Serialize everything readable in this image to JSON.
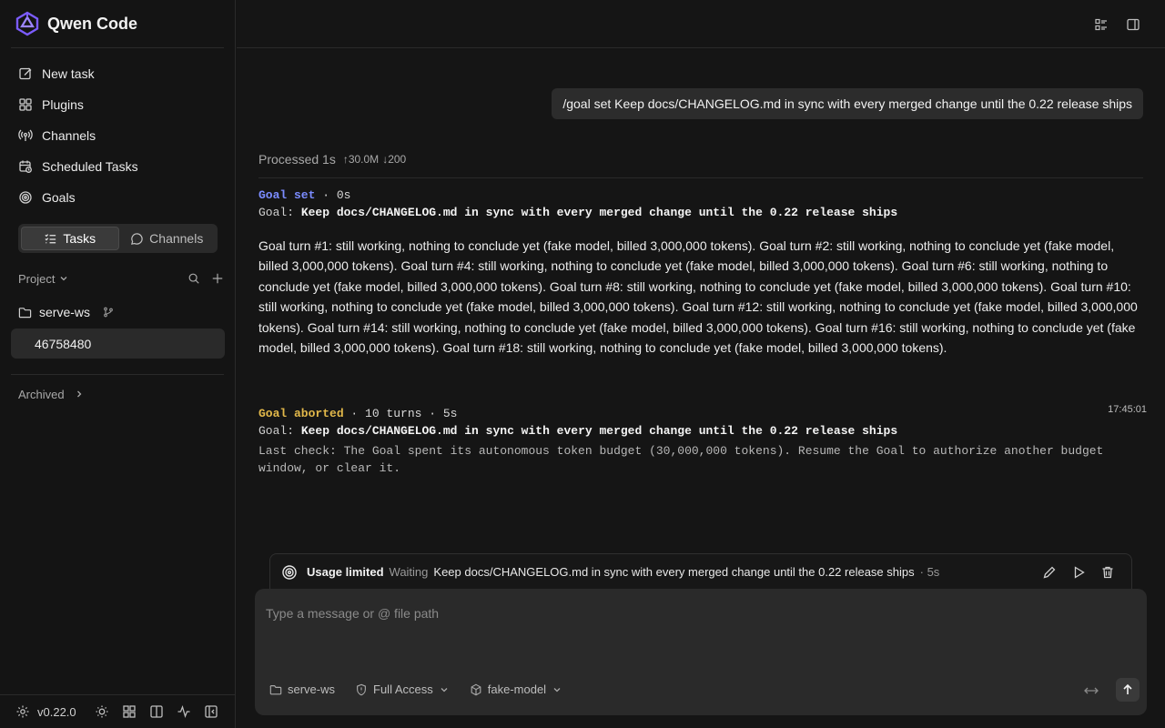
{
  "app": {
    "title": "Qwen Code",
    "version": "v0.22.0"
  },
  "sidebar": {
    "nav": [
      {
        "label": "New task",
        "icon": "edit-icon"
      },
      {
        "label": "Plugins",
        "icon": "plugins-icon"
      },
      {
        "label": "Channels",
        "icon": "broadcast-icon"
      },
      {
        "label": "Scheduled Tasks",
        "icon": "calendar-clock-icon"
      },
      {
        "label": "Goals",
        "icon": "target-icon"
      }
    ],
    "segment": {
      "tasks": "Tasks",
      "channels": "Channels",
      "active": "tasks"
    },
    "project_label": "Project",
    "folder": "serve-ws",
    "session": "46758480",
    "archived_label": "Archived"
  },
  "conversation": {
    "user_message": "/goal set Keep docs/CHANGELOG.md in sync with every merged change until the 0.22 release ships",
    "processed": {
      "label": "Processed 1s",
      "up": "↑30.0M",
      "down": "↓200"
    },
    "goal_set": {
      "status": "Goal set",
      "meta": " · 0s"
    },
    "goal_prefix": "Goal:",
    "goal_text": "Keep docs/CHANGELOG.md in sync with every merged change until the 0.22 release ships",
    "turns_paragraph": "Goal turn #1: still working, nothing to conclude yet (fake model, billed 3,000,000 tokens). Goal turn #2: still working, nothing to conclude yet (fake model, billed 3,000,000 tokens). Goal turn #4: still working, nothing to conclude yet (fake model, billed 3,000,000 tokens). Goal turn #6: still working, nothing to conclude yet (fake model, billed 3,000,000 tokens). Goal turn #8: still working, nothing to conclude yet (fake model, billed 3,000,000 tokens). Goal turn #10: still working, nothing to conclude yet (fake model, billed 3,000,000 tokens). Goal turn #12: still working, nothing to conclude yet (fake model, billed 3,000,000 tokens). Goal turn #14: still working, nothing to conclude yet (fake model, billed 3,000,000 tokens). Goal turn #16: still working, nothing to conclude yet (fake model, billed 3,000,000 tokens). Goal turn #18: still working, nothing to conclude yet (fake model, billed 3,000,000 tokens).",
    "goal_aborted": {
      "status": "Goal aborted",
      "meta": " · 10 turns · 5s",
      "time": "17:45:01"
    },
    "last_check": "Last check: The Goal spent its autonomous token budget (30,000,000 tokens). Resume the Goal to authorize another budget window, or clear it."
  },
  "goal_bar": {
    "status": "Usage limited",
    "state": "Waiting",
    "text": "Keep docs/CHANGELOG.md in sync with every merged change until the 0.22 release ships",
    "duration": "· 5s"
  },
  "composer": {
    "placeholder": "Type a message or @ file path",
    "folder": "serve-ws",
    "access": "Full Access",
    "model": "fake-model"
  },
  "colors": {
    "accent_blue": "#7b8cff",
    "accent_amber": "#e2b84a",
    "brand_purple": "#7c5cff"
  }
}
